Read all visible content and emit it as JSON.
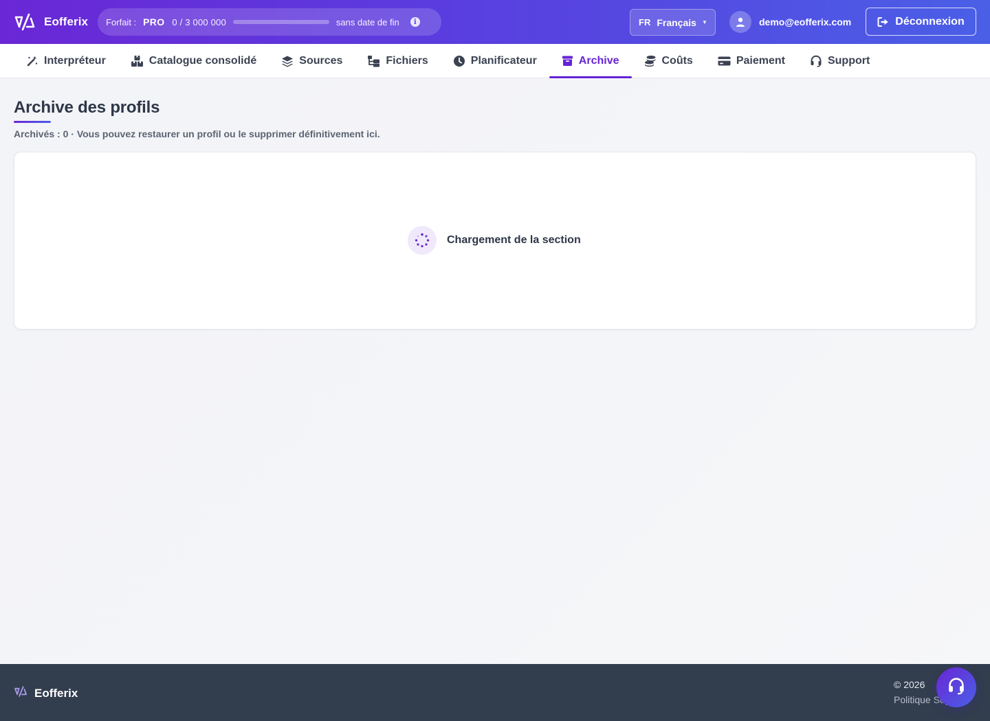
{
  "app": {
    "brand": "Eofferix"
  },
  "header": {
    "plan_label": "Forfait :",
    "plan_name": "PRO",
    "plan_usage": "0 / 3 000 000",
    "plan_usage_fraction": 0,
    "plan_end": "sans date de fin",
    "language_code": "FR",
    "language_name": "Français",
    "user_email": "demo@eofferix.com",
    "logout_label": "Déconnexion"
  },
  "nav": {
    "items": [
      {
        "label": "Interpréteur",
        "icon": "magic-wand-icon"
      },
      {
        "label": "Catalogue consolidé",
        "icon": "boxes-icon"
      },
      {
        "label": "Sources",
        "icon": "layers-icon"
      },
      {
        "label": "Fichiers",
        "icon": "folder-tree-icon"
      },
      {
        "label": "Planificateur",
        "icon": "clock-icon"
      },
      {
        "label": "Archive",
        "icon": "archive-box-icon",
        "active": true
      },
      {
        "label": "Coûts",
        "icon": "coins-icon"
      },
      {
        "label": "Paiement",
        "icon": "credit-card-icon"
      },
      {
        "label": "Support",
        "icon": "headset-icon"
      }
    ]
  },
  "main": {
    "title": "Archive des profils",
    "subtitle": "Archivés : 0 · Vous pouvez restaurer un profil ou le supprimer définitivement ici.",
    "loading_text": "Chargement de la section"
  },
  "footer": {
    "brand": "Eofferix",
    "copyright": "© 2026",
    "links_text": "Politique   Support"
  },
  "colors": {
    "accent": "#6524d6",
    "header_gradient_start": "#6a27d6",
    "header_gradient_end": "#4a5fe6",
    "footer_bg": "#323d4e"
  }
}
